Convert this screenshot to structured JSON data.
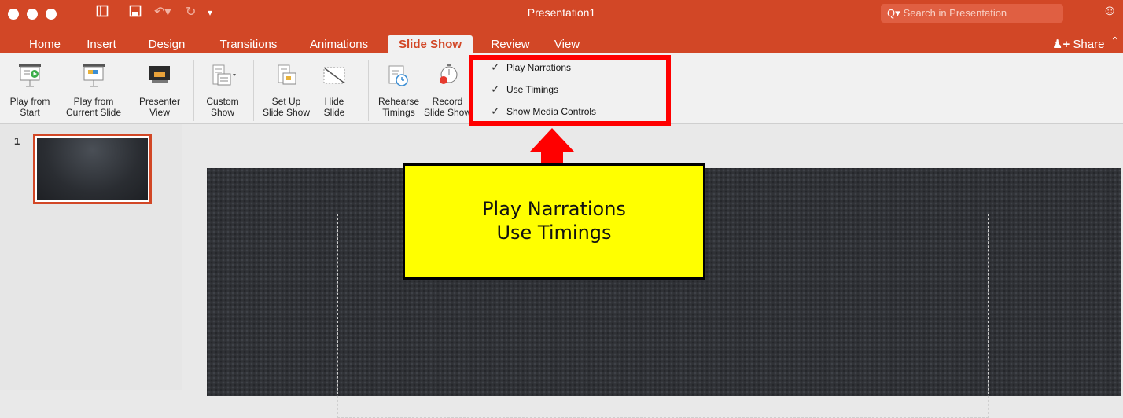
{
  "window": {
    "title": "Presentation1",
    "traffic_lights": [
      "close",
      "minimize",
      "zoom"
    ],
    "quick_access": [
      "sidebar-toggle-icon",
      "save-icon",
      "undo-icon",
      "redo-icon",
      "customize-qat-icon"
    ],
    "search_placeholder": "Search in Presentation"
  },
  "tabs": [
    {
      "label": "Home",
      "active": false
    },
    {
      "label": "Insert",
      "active": false
    },
    {
      "label": "Design",
      "active": false
    },
    {
      "label": "Transitions",
      "active": false
    },
    {
      "label": "Animations",
      "active": false
    },
    {
      "label": "Slide Show",
      "active": true
    },
    {
      "label": "Review",
      "active": false
    },
    {
      "label": "View",
      "active": false
    }
  ],
  "share_label": "Share",
  "ribbon": {
    "buttons": [
      {
        "id": "play-from-start",
        "line1": "Play from",
        "line2": "Start",
        "icon": "play-from-start-icon"
      },
      {
        "id": "play-from-current",
        "line1": "Play from",
        "line2": "Current Slide",
        "icon": "play-from-current-icon"
      },
      {
        "id": "presenter-view",
        "line1": "Presenter",
        "line2": "View",
        "icon": "presenter-view-icon"
      },
      {
        "id": "custom-show",
        "line1": "Custom",
        "line2": "Show",
        "icon": "custom-show-icon"
      },
      {
        "id": "set-up-slide-show",
        "line1": "Set Up",
        "line2": "Slide Show",
        "icon": "set-up-slide-show-icon"
      },
      {
        "id": "hide-slide",
        "line1": "Hide",
        "line2": "Slide",
        "icon": "hide-slide-icon"
      },
      {
        "id": "rehearse-timings",
        "line1": "Rehearse",
        "line2": "Timings",
        "icon": "rehearse-timings-icon"
      },
      {
        "id": "record-slide-show",
        "line1": "Record",
        "line2": "Slide Show",
        "icon": "record-slide-show-icon"
      }
    ],
    "checkboxes": [
      {
        "label": "Play Narrations",
        "checked": true
      },
      {
        "label": "Use Timings",
        "checked": true
      },
      {
        "label": "Show Media Controls",
        "checked": true
      }
    ]
  },
  "slides": [
    {
      "number": "1",
      "selected": true
    }
  ],
  "callout": {
    "line1": "Play Narrations",
    "line2": "Use Timings"
  },
  "colors": {
    "accent": "#d24726",
    "annotation_red": "#ff0000",
    "callout_yellow": "#ffff00"
  }
}
